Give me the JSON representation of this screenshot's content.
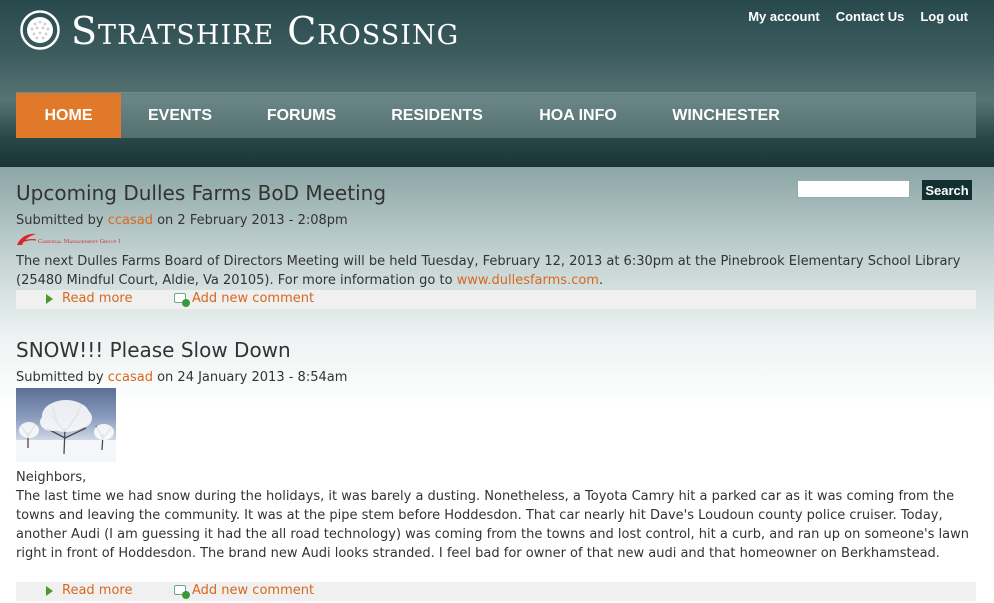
{
  "site": {
    "name": "Stratshire Crossing",
    "logo_icon": "golf-ball-icon"
  },
  "secondary_links": [
    "My account",
    "Contact Us",
    "Log out"
  ],
  "nav": {
    "items": [
      {
        "label": "HOME",
        "active": true
      },
      {
        "label": "EVENTS",
        "active": false
      },
      {
        "label": "FORUMS",
        "active": false
      },
      {
        "label": "RESIDENTS",
        "active": false
      },
      {
        "label": "HOA INFO",
        "active": false
      },
      {
        "label": "WINCHESTER",
        "active": false
      }
    ]
  },
  "search": {
    "value": "",
    "button_label": "Search"
  },
  "colors": {
    "accent": "#e07a2a",
    "link": "#d8681d",
    "header_dark": "#183434"
  },
  "posts": [
    {
      "title": "Upcoming Dulles Farms BoD Meeting",
      "submitted_prefix": "Submitted by",
      "author": "ccasad",
      "date_text": "on 2 February 2013 - 2:08pm",
      "image_caption": "Cardinal Management Group Inc",
      "body_text": "The next Dulles Farms Board of Directors Meeting will be held Tuesday, February 12, 2013 at 6:30pm at the Pinebrook Elementary School Library (25480 Mindful Court, Aldie, Va 20105). For more information go to ",
      "body_link": "www.dullesfarms.com",
      "body_end": ".",
      "read_more": "Read more",
      "add_comment": "Add new comment"
    },
    {
      "title": "SNOW!!! Please Slow Down",
      "submitted_prefix": "Submitted by",
      "author": "ccasad",
      "date_text": "on 24 January 2013 - 8:54am",
      "greeting": "Neighbors,",
      "body_text": "The last time we had snow during the holidays, it was barely a dusting. Nonetheless, a Toyota Camry hit a parked car as it was coming from the towns and leaving the community. It was at the pipe stem before Hoddesdon. That car nearly hit Dave's Loudoun county police cruiser. Today, another Audi (I am guessing it had the all road technology) was coming from the towns and lost control, hit a curb, and ran up on someone's lawn right in front of Hoddesdon. The brand new Audi looks stranded. I feel bad for owner of that new audi and that homeowner on Berkhamstead.",
      "read_more": "Read more",
      "add_comment": "Add new comment"
    }
  ]
}
